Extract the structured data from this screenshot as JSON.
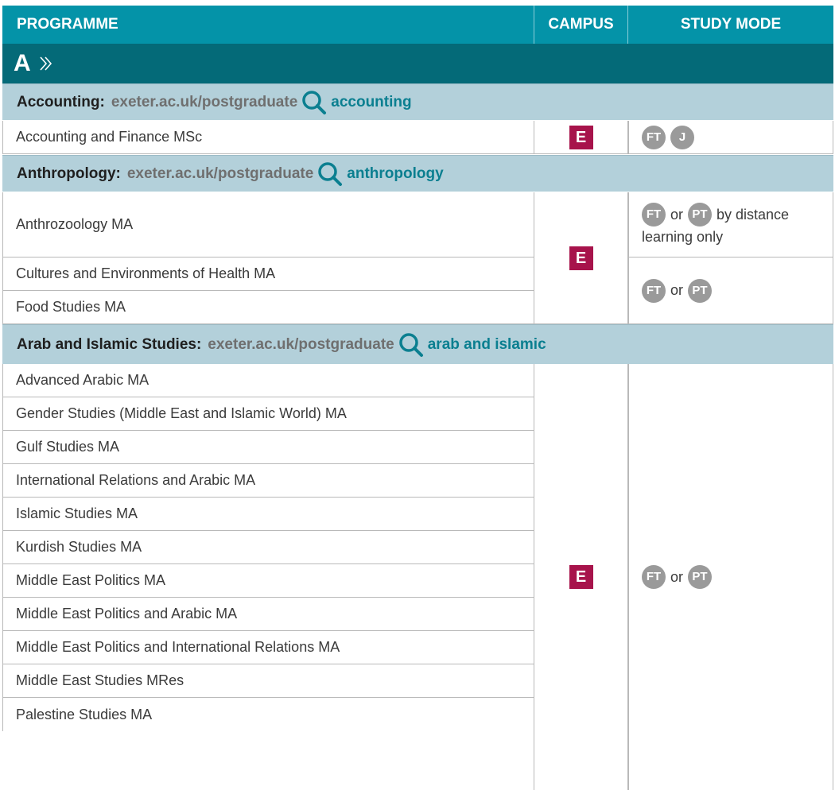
{
  "header": {
    "programme": "PROGRAMME",
    "campus": "CAMPUS",
    "study_mode": "STUDY MODE"
  },
  "letter": "A",
  "sections": [
    {
      "name": "Accounting:",
      "url": "exeter.ac.uk/postgraduate",
      "keyword": "accounting",
      "programmes": [
        "Accounting and Finance MSc"
      ],
      "campus": "E",
      "modes": {
        "pill1": "FT",
        "pill2": "J"
      }
    },
    {
      "name": "Anthropology:",
      "url": "exeter.ac.uk/postgraduate",
      "keyword": "anthropology",
      "programmes": [
        "Anthrozoology MA",
        "Cultures and Environments of Health MA",
        "Food Studies MA"
      ],
      "campus": "E",
      "modes": {
        "a_pill1": "FT",
        "a_or": "or",
        "a_pill2": "PT",
        "a_rest": "by distance",
        "a_line2": "learning only",
        "b_pill1": "FT",
        "b_or": "or",
        "b_pill2": "PT"
      }
    },
    {
      "name": "Arab and Islamic Studies:",
      "url": "exeter.ac.uk/postgraduate",
      "keyword": "arab and islamic",
      "programmes": [
        "Advanced Arabic MA",
        "Gender Studies (Middle East and Islamic World) MA",
        "Gulf Studies MA",
        "International Relations and Arabic MA",
        "Islamic Studies MA",
        "Kurdish Studies MA",
        "Middle East Politics MA",
        "Middle East Politics and Arabic MA",
        "Middle East Politics and International Relations MA",
        "Middle East Studies MRes",
        "Palestine Studies MA"
      ],
      "campus": "E",
      "modes": {
        "pill1": "FT",
        "or": "or",
        "pill2": "PT"
      }
    }
  ],
  "colors": {
    "header_teal": "#0493a8",
    "letter_bar": "#046a78",
    "subject_bar": "#b3d0da",
    "campus_badge": "#a7134b",
    "mode_pill": "#9a9a9a",
    "keyword": "#0b7f90"
  },
  "icons": {
    "search": "magnifier-icon",
    "chevron": "double-chevron-right-icon"
  }
}
